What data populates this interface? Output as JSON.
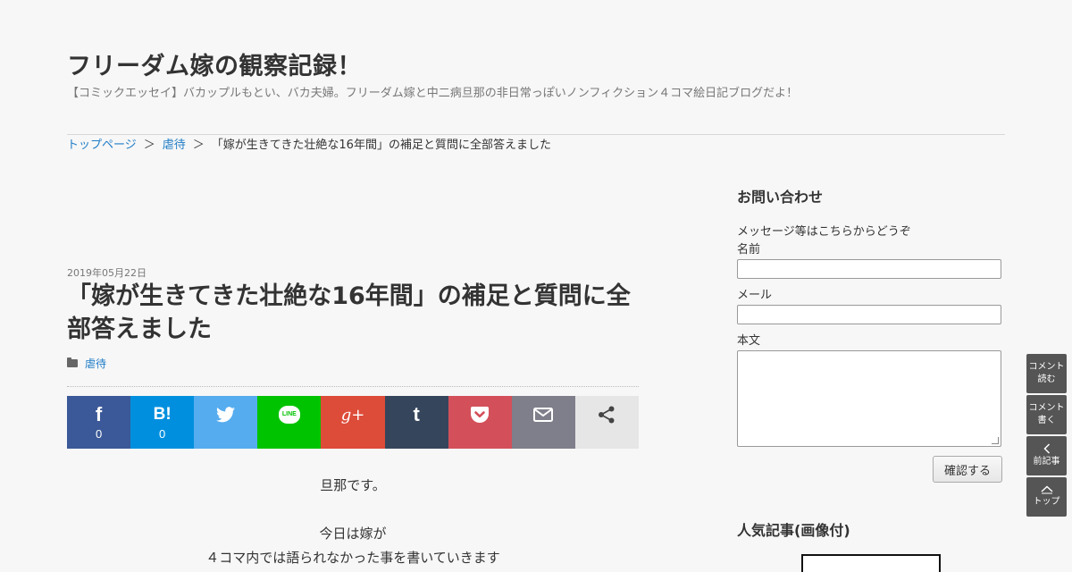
{
  "site": {
    "title": "フリーダム嫁の観察記録！",
    "description": "【コミックエッセイ】バカップルもとい、バカ夫婦。フリーダム嫁と中二病旦那の非日常っぽいノンフィクション４コマ絵日記ブログだよ！"
  },
  "breadcrumb": {
    "home": "トップページ",
    "sep": "＞",
    "category": "虐待",
    "current": "「嫁が生きてきた壮絶な16年間」の補足と質問に全部答えました"
  },
  "post": {
    "date": "2019年05月22日",
    "title": "「嫁が生きてきた壮絶な16年間」の補足と質問に全部答えました",
    "category": "虐待",
    "body": [
      "旦那です。",
      "",
      "今日は嫁が",
      "４コマ内では語られなかった事を書いていきます"
    ]
  },
  "share": [
    {
      "name": "facebook",
      "glyph": "f",
      "count": "0",
      "color": "#3b5998"
    },
    {
      "name": "hatena",
      "glyph": "B!",
      "count": "0",
      "color": "#008fde"
    },
    {
      "name": "twitter",
      "glyph": "",
      "count": "",
      "color": "#55acee"
    },
    {
      "name": "line",
      "glyph": "LINE",
      "count": "",
      "color": "#00c300"
    },
    {
      "name": "googleplus",
      "glyph": "g+",
      "count": "",
      "color": "#dd4b39"
    },
    {
      "name": "tumblr",
      "glyph": "t",
      "count": "",
      "color": "#35465c"
    },
    {
      "name": "pocket",
      "glyph": "",
      "count": "",
      "color": "#d3505a"
    },
    {
      "name": "mail",
      "glyph": "",
      "count": "",
      "color": "#7f7f8b"
    },
    {
      "name": "share",
      "glyph": "",
      "count": "",
      "color": "#e6e6e6"
    }
  ],
  "sidebar": {
    "contact_title": "お問い合わせ",
    "contact_intro": "メッセージ等はこちらからどうぞ",
    "name_label": "名前",
    "mail_label": "メール",
    "body_label": "本文",
    "submit_label": "確認する",
    "popular_title": "人気記事(画像付)"
  },
  "floating": {
    "comment_read": [
      "コメント",
      "読む"
    ],
    "comment_write": [
      "コメント",
      "書く"
    ],
    "prev": "前記事",
    "top": "トップ"
  }
}
